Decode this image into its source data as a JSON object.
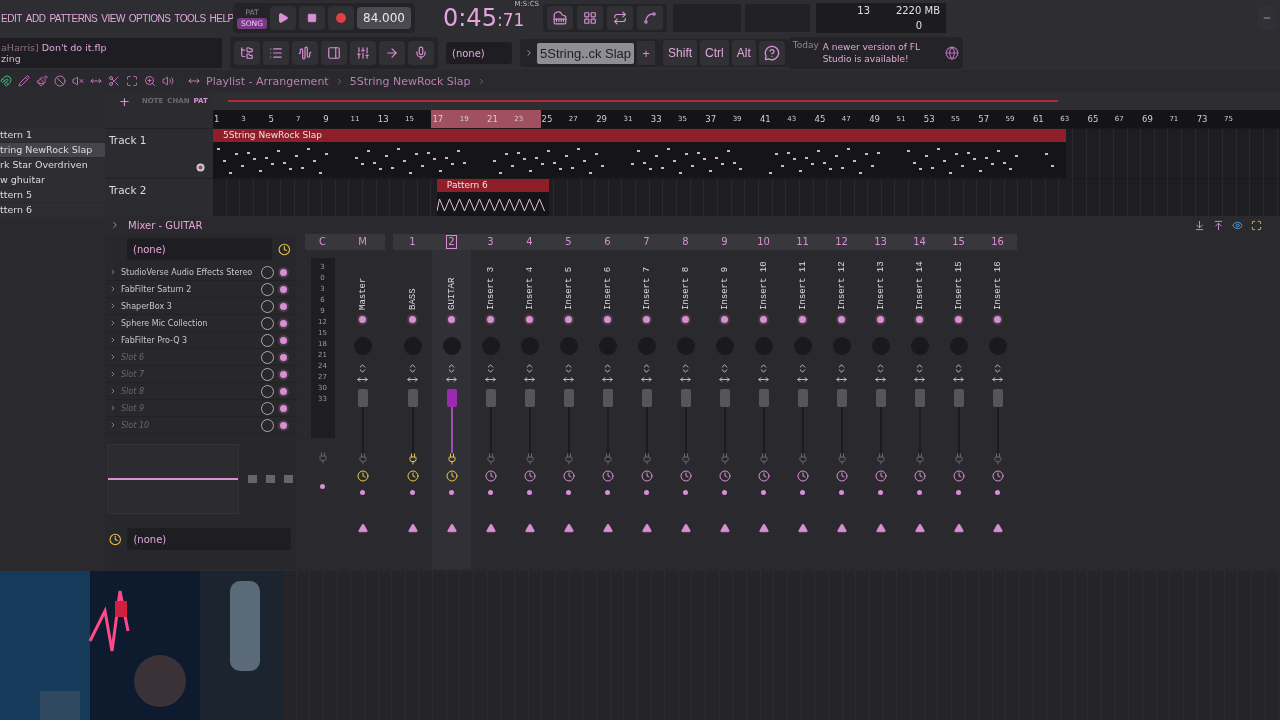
{
  "menu": [
    "EDIT",
    "ADD",
    "PATTERNS",
    "VIEW",
    "OPTIONS",
    "TOOLS",
    "HELP"
  ],
  "transport": {
    "modes": [
      {
        "label": "PAT",
        "selected": false
      },
      {
        "label": "SONG",
        "selected": true
      }
    ],
    "tempo": "84.000",
    "time": "0:45",
    "time_cs": ":71",
    "time_format": "M:S:CS"
  },
  "cpu": {
    "voices": "13",
    "memory": "2220 MB",
    "polyphony": "0"
  },
  "hint": {
    "user": "aHarris]",
    "file": "Don't do it.flp",
    "line2": "zing"
  },
  "toolbar": {
    "channel_selector": "(none)",
    "pattern": "5String..ck Slap",
    "add": "+",
    "modifiers": [
      "Shift",
      "Ctrl",
      "Alt"
    ],
    "news_day": "Today",
    "news": "A newer version of FL Studio is available!"
  },
  "playlist": {
    "title": "Playlist - Arrangement",
    "pattern_name": "5String NewRock Slap",
    "add": "+",
    "picker_tabs": [
      {
        "label": "NOTE",
        "selected": false
      },
      {
        "label": "CHAN",
        "selected": false
      },
      {
        "label": "PAT",
        "selected": true
      }
    ],
    "patterns": [
      {
        "name": "ttern 1",
        "selected": false
      },
      {
        "name": "tring NewRock Slap",
        "selected": true
      },
      {
        "name": "rk Star Overdriven",
        "selected": false
      },
      {
        "name": "w ghuitar",
        "selected": false
      },
      {
        "name": "ttern 5",
        "selected": false
      },
      {
        "name": "ttern 6",
        "selected": false
      }
    ],
    "ruler": [
      {
        "label": "1",
        "loop": false
      },
      {
        "label": "3",
        "loop": false
      },
      {
        "label": "5",
        "loop": false
      },
      {
        "label": "7",
        "loop": false
      },
      {
        "label": "9",
        "loop": false
      },
      {
        "label": "11",
        "loop": false
      },
      {
        "label": "13",
        "loop": false
      },
      {
        "label": "15",
        "loop": false
      },
      {
        "label": "17",
        "loop": true
      },
      {
        "label": "19",
        "loop": true
      },
      {
        "label": "21",
        "loop": true
      },
      {
        "label": "23",
        "loop": true
      },
      {
        "label": "25",
        "loop": false
      },
      {
        "label": "27",
        "loop": false
      },
      {
        "label": "29",
        "loop": false
      },
      {
        "label": "31",
        "loop": false
      },
      {
        "label": "33",
        "loop": false
      },
      {
        "label": "35",
        "loop": false
      },
      {
        "label": "37",
        "loop": false
      },
      {
        "label": "39",
        "loop": false
      },
      {
        "label": "41",
        "loop": false
      },
      {
        "label": "43",
        "loop": false
      },
      {
        "label": "45",
        "loop": false
      },
      {
        "label": "47",
        "loop": false
      },
      {
        "label": "49",
        "loop": false
      },
      {
        "label": "51",
        "loop": false
      },
      {
        "label": "53",
        "loop": false
      },
      {
        "label": "55",
        "loop": false
      },
      {
        "label": "57",
        "loop": false
      },
      {
        "label": "59",
        "loop": false
      },
      {
        "label": "61",
        "loop": false
      },
      {
        "label": "63",
        "loop": false
      },
      {
        "label": "65",
        "loop": false
      },
      {
        "label": "67",
        "loop": false
      },
      {
        "label": "69",
        "loop": false
      },
      {
        "label": "71",
        "loop": false
      },
      {
        "label": "73",
        "loop": false
      },
      {
        "label": "75",
        "loop": false
      }
    ],
    "tracks": [
      {
        "name": "Track 1",
        "clips": [
          {
            "name": "5String NewRock Slap",
            "kind": "notes"
          }
        ]
      },
      {
        "name": "Track 2",
        "clips": [
          {
            "name": "Pattern 6",
            "kind": "wave"
          }
        ]
      }
    ]
  },
  "mixer": {
    "title": "Mixer - GUITAR",
    "input": "(none)",
    "output": "(none)",
    "scale_header": "C",
    "scale": [
      "3",
      "0",
      "3",
      "6",
      "9",
      "12",
      "15",
      "18",
      "21",
      "24",
      "27",
      "30",
      "33"
    ],
    "slots": [
      {
        "name": "StudioVerse Audio Effects Stereo",
        "empty": false
      },
      {
        "name": "FabFilter Saturn 2",
        "empty": false
      },
      {
        "name": "ShaperBox 3",
        "empty": false
      },
      {
        "name": "Sphere Mic Collection",
        "empty": false
      },
      {
        "name": "FabFilter Pro-Q 3",
        "empty": false
      },
      {
        "name": "Slot 6",
        "empty": true
      },
      {
        "name": "Slot 7",
        "empty": true
      },
      {
        "name": "Slot 8",
        "empty": true
      },
      {
        "name": "Slot 9",
        "empty": true
      },
      {
        "name": "Slot 10",
        "empty": true
      }
    ],
    "strips": [
      {
        "number": "M",
        "name": "Master",
        "selected": false,
        "cable_on": false,
        "timer_on": true
      },
      {
        "number": "1",
        "name": "BASS",
        "selected": false,
        "cable_on": true,
        "timer_on": true
      },
      {
        "number": "2",
        "name": "GUITAR",
        "selected": true,
        "cable_on": true,
        "timer_on": true
      },
      {
        "number": "3",
        "name": "Insert 3",
        "selected": false,
        "cable_on": false,
        "timer_on": false
      },
      {
        "number": "4",
        "name": "Insert 4",
        "selected": false,
        "cable_on": false,
        "timer_on": false
      },
      {
        "number": "5",
        "name": "Insert 5",
        "selected": false,
        "cable_on": false,
        "timer_on": false
      },
      {
        "number": "6",
        "name": "Insert 6",
        "selected": false,
        "cable_on": false,
        "timer_on": false
      },
      {
        "number": "7",
        "name": "Insert 7",
        "selected": false,
        "cable_on": false,
        "timer_on": false
      },
      {
        "number": "8",
        "name": "Insert 8",
        "selected": false,
        "cable_on": false,
        "timer_on": false
      },
      {
        "number": "9",
        "name": "Insert 9",
        "selected": false,
        "cable_on": false,
        "timer_on": false
      },
      {
        "number": "10",
        "name": "Insert 10",
        "selected": false,
        "cable_on": false,
        "timer_on": false
      },
      {
        "number": "11",
        "name": "Insert 11",
        "selected": false,
        "cable_on": false,
        "timer_on": false
      },
      {
        "number": "12",
        "name": "Insert 12",
        "selected": false,
        "cable_on": false,
        "timer_on": false
      },
      {
        "number": "13",
        "name": "Insert 13",
        "selected": false,
        "cable_on": false,
        "timer_on": false
      },
      {
        "number": "14",
        "name": "Insert 14",
        "selected": false,
        "cable_on": false,
        "timer_on": false
      },
      {
        "number": "15",
        "name": "Insert 15",
        "selected": false,
        "cable_on": false,
        "timer_on": false
      },
      {
        "number": "16",
        "name": "Insert 16",
        "selected": false,
        "cable_on": false,
        "timer_on": false
      }
    ]
  }
}
